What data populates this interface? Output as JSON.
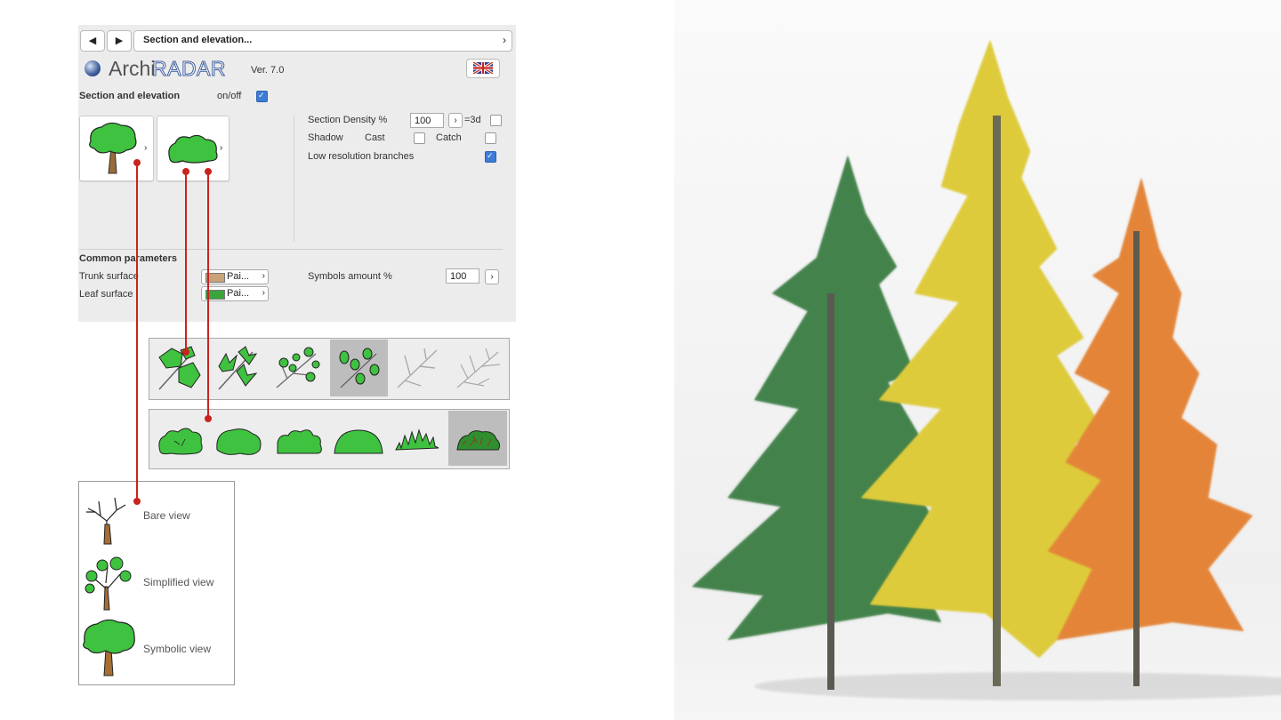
{
  "navigation": {
    "back_label": "◀",
    "forward_label": "▶",
    "path_title": "Section and elevation...",
    "path_chevron": "›"
  },
  "logo": {
    "archi": "Archi",
    "radar": "RADAR",
    "version": "Ver. 7.0"
  },
  "section": {
    "title": "Section and elevation",
    "onoff_label": "on/off",
    "onoff_checked": true,
    "density_label": "Section Density %",
    "density_value": "100",
    "eq3d_label": "=3d",
    "eq3d_checked": false,
    "shadow_label": "Shadow",
    "cast_label": "Cast",
    "cast_checked": false,
    "catch_label": "Catch",
    "catch_checked": false,
    "lowres_label": "Low resolution branches",
    "lowres_checked": true
  },
  "common": {
    "title": "Common parameters",
    "trunk_label": "Trunk surface",
    "trunk_value": "Pai...",
    "trunk_color": "#c9a27a",
    "leaf_label": "Leaf surface",
    "leaf_value": "Pai...",
    "leaf_color": "#3aa53a",
    "symbols_label": "Symbols amount %",
    "symbols_value": "100"
  },
  "leaf_styles": {
    "count": 6,
    "selected_index": 3
  },
  "canopy_styles": {
    "count": 6,
    "selected_index": 5
  },
  "views": [
    {
      "label": "Bare view"
    },
    {
      "label": "Simplified view"
    },
    {
      "label": "Symbolic view"
    }
  ],
  "colors": {
    "connector": "#c8241e",
    "foliage": "#3fc23f",
    "trunk": "#9a6a3a",
    "checkbox_on": "#3d7bd6",
    "tree_green": "#3e7a46",
    "tree_yellow": "#d9c530",
    "tree_orange": "#de7a2a"
  }
}
